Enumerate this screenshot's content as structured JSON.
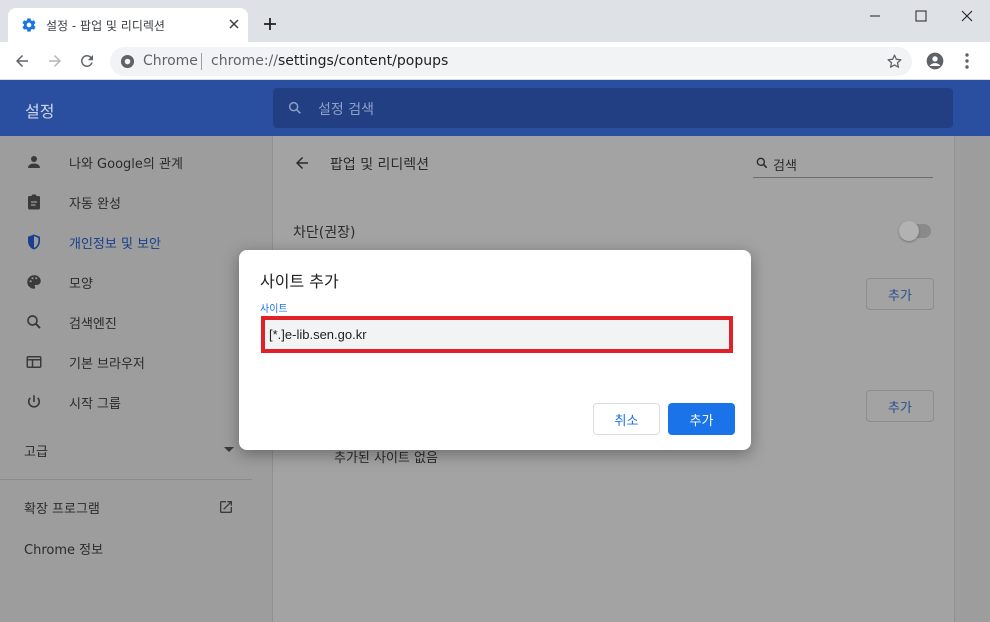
{
  "browser": {
    "tab_title": "설정 - 팝업 및 리디렉션",
    "omnibox_chip": "Chrome",
    "url_prefix": "chrome://",
    "url_path": "settings/content/popups"
  },
  "header": {
    "app_title": "설정",
    "search_placeholder": "설정 검색"
  },
  "sidebar": {
    "items": [
      {
        "label": "나와 Google의 관계",
        "icon": "person-icon"
      },
      {
        "label": "자동 완성",
        "icon": "clipboard-icon"
      },
      {
        "label": "개인정보 및 보안",
        "icon": "shield-icon"
      },
      {
        "label": "모양",
        "icon": "palette-icon"
      },
      {
        "label": "검색엔진",
        "icon": "search-icon"
      },
      {
        "label": "기본 브라우저",
        "icon": "browser-icon"
      },
      {
        "label": "시작 그룹",
        "icon": "power-icon"
      }
    ],
    "advanced": "고급",
    "extensions": "확장 프로그램",
    "about": "Chrome 정보"
  },
  "card": {
    "title": "팝업 및 리디렉션",
    "search_placeholder": "검색",
    "block_label": "차단(권장)",
    "add_button_1": "추가",
    "add_button_2": "추가",
    "empty_text": "추가된 사이트 없음"
  },
  "dialog": {
    "title": "사이트 추가",
    "field_label": "사이트",
    "field_value": "[*.]e-lib.sen.go.kr",
    "cancel": "취소",
    "add": "추가"
  },
  "colors": {
    "accent": "#1a73e8",
    "header_blue": "#2a4fa1",
    "highlight_red": "#e02128"
  }
}
